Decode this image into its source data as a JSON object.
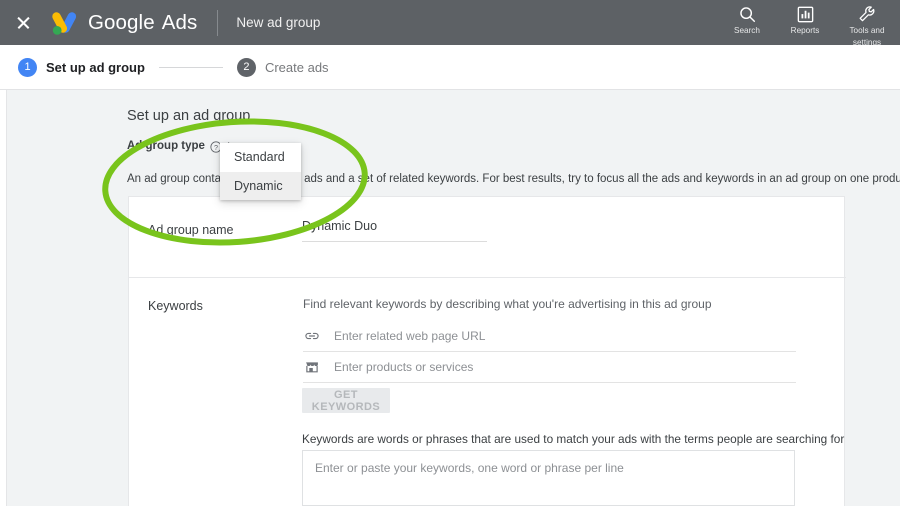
{
  "header": {
    "close_icon": "close-icon",
    "logo_icon": "google-ads-logo",
    "brand_google": "Google",
    "brand_ads": "Ads",
    "page_subtitle": "New ad group",
    "actions": [
      {
        "icon": "search-icon",
        "label": "Search"
      },
      {
        "icon": "reports-icon",
        "label": "Reports"
      },
      {
        "icon": "tools-icon",
        "label": "Tools and\nsettings",
        "label_line1": "Tools and",
        "label_line2": "settings"
      }
    ]
  },
  "stepper": {
    "steps": [
      {
        "number": "1",
        "label": "Set up ad group",
        "state": "active"
      },
      {
        "number": "2",
        "label": "Create ads",
        "state": "inactive"
      }
    ]
  },
  "main": {
    "section_title": "Set up an ad group",
    "ad_group_type": {
      "label": "Ad group type",
      "help_icon": "help-circle-icon",
      "colon": ":",
      "options": [
        {
          "label": "Standard",
          "hovered": false
        },
        {
          "label": "Dynamic",
          "hovered": true
        }
      ]
    },
    "description": "An ad group contains one or more ads and a set of related keywords. For best results, try to focus all the ads and keywords in an ad group on one product or service.",
    "ad_group_name": {
      "label": "Ad group name",
      "value": "Dynamic Duo",
      "placeholder": ""
    },
    "keywords": {
      "label": "Keywords",
      "description": "Find relevant keywords by describing what you're advertising in this ad group",
      "url_field": {
        "icon": "link-icon",
        "placeholder": "Enter related web page URL",
        "value": ""
      },
      "products_field": {
        "icon": "storefront-icon",
        "placeholder": "Enter products or services",
        "value": ""
      },
      "get_keywords_button": "GET KEYWORDS",
      "note": "Keywords are words or phrases that are used to match your ads with the terms people are searching for",
      "textarea_placeholder": "Enter or paste your keywords, one word or phrase per line",
      "textarea_value": ""
    }
  },
  "annotation": {
    "shape": "ellipse-highlight",
    "color": "#79c41c"
  },
  "colors": {
    "header_bg": "#5d6165",
    "accent_blue": "#4285f4",
    "page_bg": "#f1f3f4",
    "annotation_green": "#79c41c"
  }
}
